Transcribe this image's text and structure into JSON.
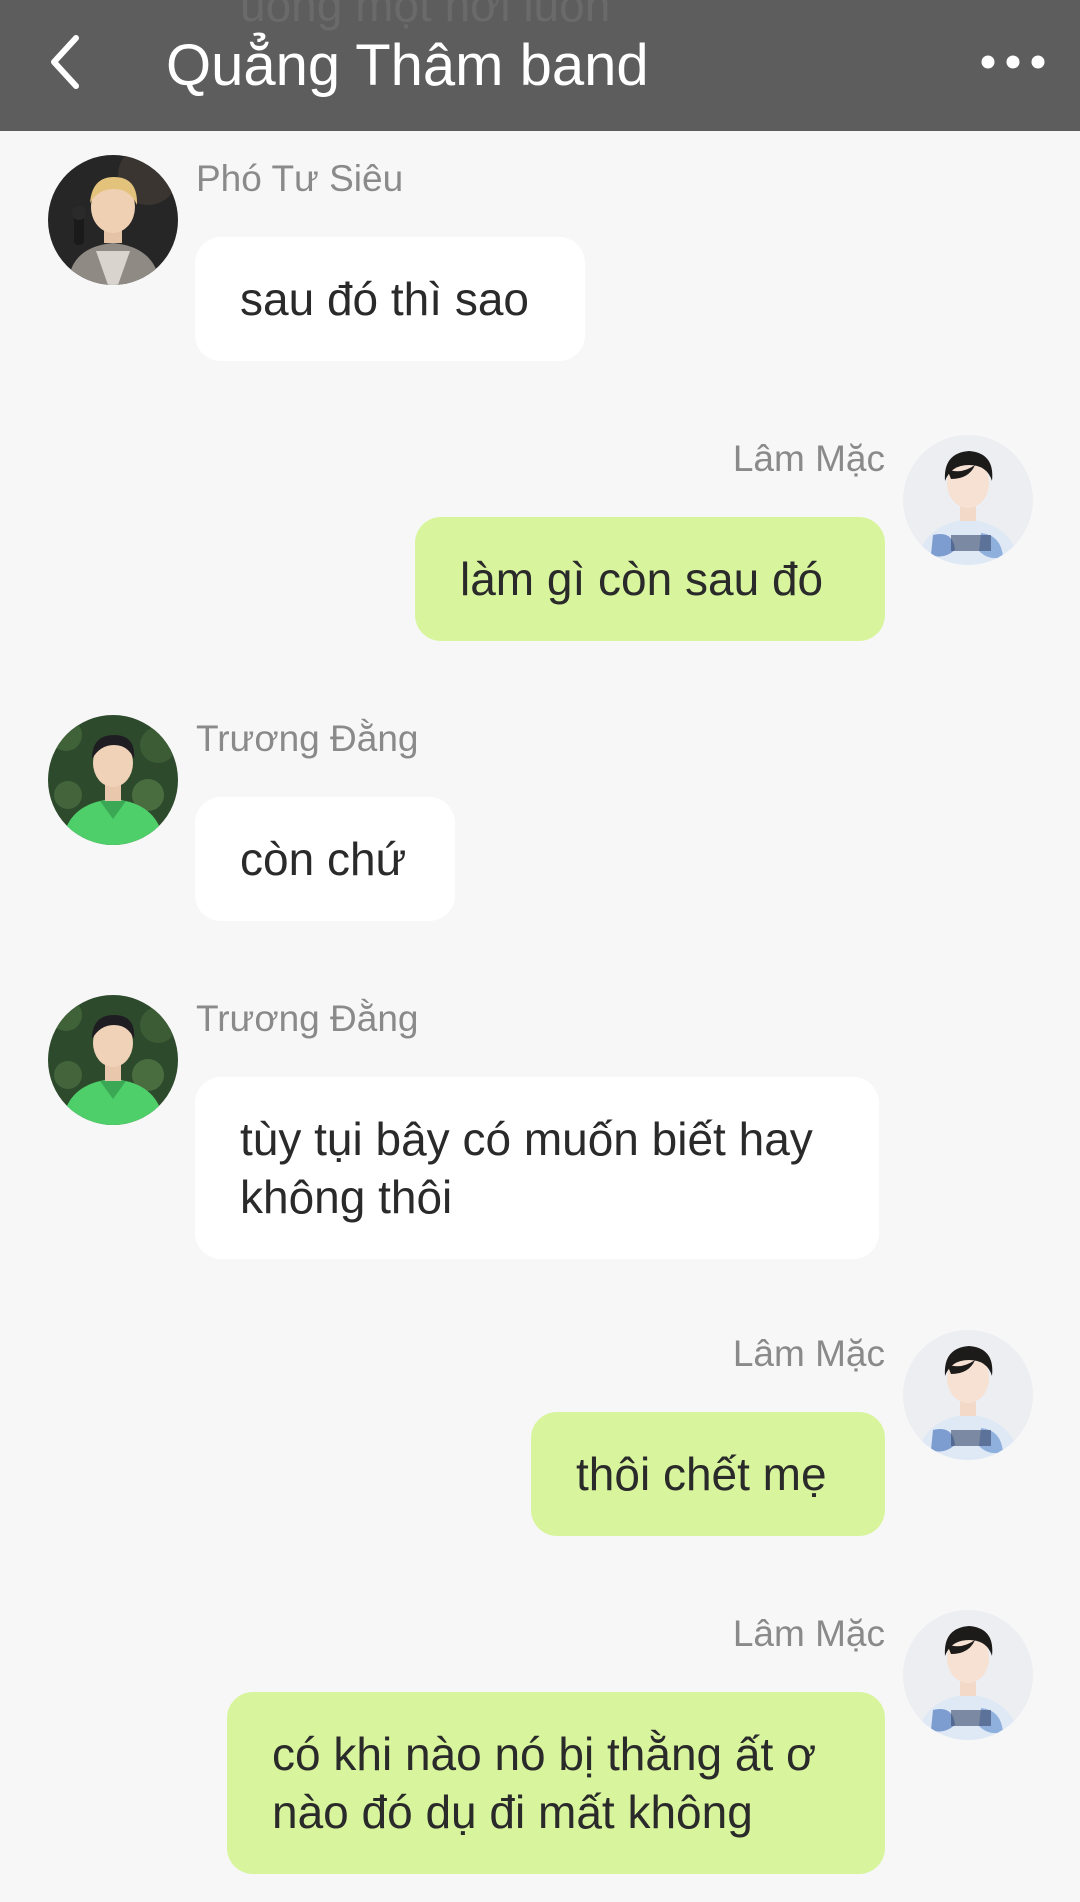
{
  "header": {
    "title": "Quẳng Thâm band",
    "ghost_text": "uống một hơi luôn",
    "back_icon": "chevron-left-icon",
    "more_icon": "more-horizontal-icon"
  },
  "messages": [
    {
      "sender": "Phó Tư Siêu",
      "text": "sau đó thì sao",
      "side": "left"
    },
    {
      "sender": "Lâm Mặc",
      "text": "làm gì còn sau đó",
      "side": "right"
    },
    {
      "sender": "Trương Đằng",
      "text": "còn chứ",
      "side": "left"
    },
    {
      "sender": "Trương Đằng",
      "text": "tùy tụi bây có muốn biết hay không thôi",
      "side": "left"
    },
    {
      "sender": "Lâm Mặc",
      "text": "thôi chết mẹ",
      "side": "right"
    },
    {
      "sender": "Lâm Mặc",
      "text": "có khi nào nó bị thằng ất ơ nào đó dụ đi mất không",
      "side": "right"
    }
  ],
  "colors": {
    "header_bg": "#5d5d5d",
    "page_bg": "#f7f7f7",
    "incoming_bubble": "#ffffff",
    "outgoing_bubble": "#d8f59d"
  }
}
